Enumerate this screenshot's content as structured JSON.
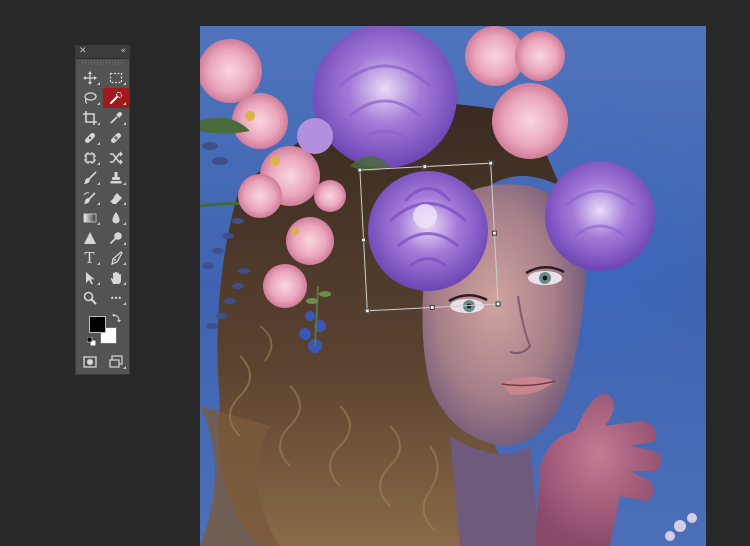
{
  "tools_panel": {
    "close_icon": "close-icon",
    "collapse_icon": "collapse-panel-icon",
    "active_tool": "quick-selection-tool",
    "tools": [
      [
        "move-tool",
        "rectangular-marquee-tool"
      ],
      [
        "lasso-tool",
        "quick-selection-tool"
      ],
      [
        "crop-tool",
        "eyedropper-tool"
      ],
      [
        "spot-healing-brush-tool",
        "healing-brush-tool"
      ],
      [
        "content-aware-move-tool",
        "patch-tool"
      ],
      [
        "brush-tool",
        "clone-stamp-tool"
      ],
      [
        "history-brush-tool",
        "eraser-tool"
      ],
      [
        "gradient-tool",
        "blur-tool"
      ],
      [
        "sharpen-tool",
        "dodge-tool"
      ],
      [
        "type-tool",
        "pen-tool"
      ],
      [
        "path-selection-tool",
        "hand-tool"
      ],
      [
        "zoom-tool",
        "more-tools"
      ]
    ],
    "type_tool_glyph": "T",
    "more_tools_glyph": "•••"
  },
  "colors": {
    "foreground": "#000000",
    "background": "#ffffff",
    "active_tool_bg": "#a2191e",
    "app_background": "#282828",
    "panel_background": "#535353"
  },
  "canvas": {
    "selection_state": "free-transform"
  }
}
